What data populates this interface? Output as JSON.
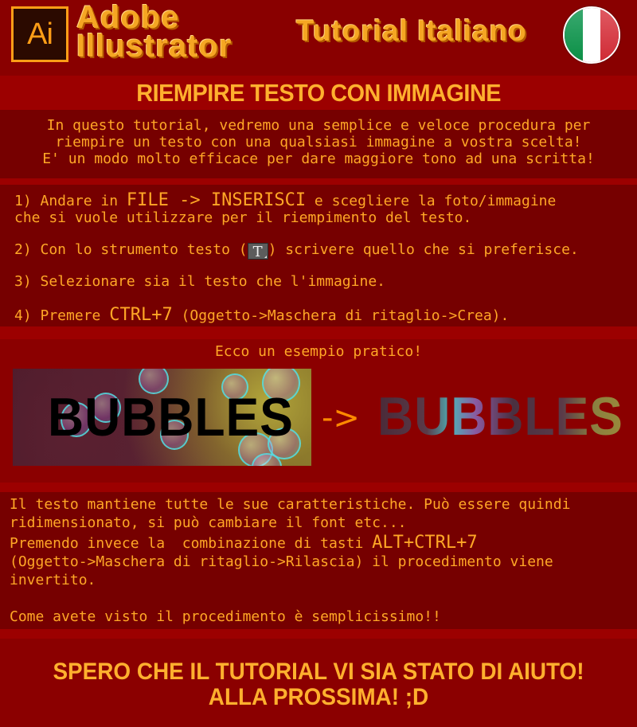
{
  "header": {
    "logo_text": "Ai",
    "brand_line1": "Adobe",
    "brand_line2": "Illustrator",
    "subtitle": "Tutorial Italiano",
    "flag": "italian-flag"
  },
  "title": "RIEMPIRE TESTO CON IMMAGINE",
  "intro": [
    "In questo tutorial, vedremo una semplice e veloce procedura per",
    "riempire un testo con una qualsiasi immagine a vostra scelta!",
    "E' un modo molto efficace per dare maggiore tono ad una scritta!"
  ],
  "steps": {
    "s1_prefix": "1) Andare in ",
    "s1_menu": "FILE -> INSERISCI",
    "s1_suffix": " e scegliere la foto/immagine",
    "s1_line2": "che si vuole utilizzare per il riempimento del testo.",
    "s2_prefix": "2) Con lo strumento testo (",
    "s2_tool_glyph": "T",
    "s2_suffix": ") scrivere quello che si preferisce.",
    "s3": "3) Selezionare sia il testo che l'immagine.",
    "s4_prefix": "4) Premere ",
    "s4_shortcut": "CTRL+7",
    "s4_suffix": " (Oggetto->Maschera di ritaglio->Crea)."
  },
  "example": {
    "caption": "Ecco un esempio pratico!",
    "before_text": "BUBBLES",
    "arrow": "->",
    "after_text": "BUBBLES"
  },
  "notes": {
    "n1": "Il testo mantiene tutte le sue caratteristiche. Può essere quindi",
    "n2": "ridimensionato, si può cambiare il font etc...",
    "n3_prefix": "Premendo invece la  combinazione di tasti ",
    "n3_shortcut": "ALT+CTRL+7",
    "n4": "(Oggetto->Maschera di ritaglio->Rilascia) il procedimento viene",
    "n5": "invertito.",
    "n6": "Come avete visto il procedimento è semplicissimo!!"
  },
  "outro": {
    "line1": "SPERO CHE IL TUTORIAL VI SIA STATO DI AIUTO!",
    "line2": "ALLA PROSSIMA! ;D"
  },
  "colors": {
    "background": "#8a0000",
    "panel": "#760000",
    "band": "#9c0000",
    "accent": "#ffa726",
    "arrow": "#ff8a00"
  }
}
